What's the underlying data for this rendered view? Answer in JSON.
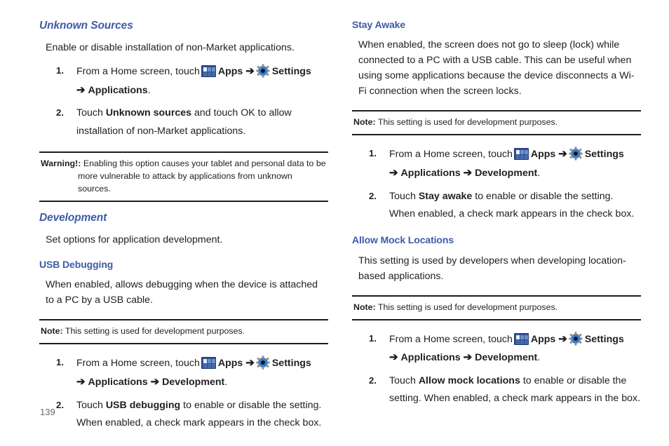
{
  "page": {
    "number": "139",
    "accent_heading_color": "#3d5ba9",
    "rule_color": "#1c1c1c",
    "body_color": "#1f1f1f"
  },
  "icons": {
    "apps": "apps-grid-icon",
    "settings": "settings-gear-icon",
    "arrow": "➔"
  },
  "left_column": {
    "section_unknown_sources": {
      "heading": "Unknown Sources",
      "intro": "Enable or disable installation of non-Market applications.",
      "steps": [
        {
          "number": "1.",
          "pre": "From a Home screen, touch",
          "apps_label": "Apps",
          "settings_label": "Settings",
          "tail_bold": "Applications",
          "tail_end": "."
        },
        {
          "number": "2.",
          "lead": "Touch",
          "bold": "Unknown sources",
          "rest": "and touch OK to allow installation of non-Market applications."
        }
      ]
    },
    "warning_callout": {
      "lead": "Warning!:",
      "line1": "Enabling this option causes your tablet and personal data to be",
      "line2": "more vulnerable to attack by applications from unknown sources."
    },
    "section_development": {
      "heading": "Development",
      "intro": "Set options for application development."
    },
    "section_usb_debugging": {
      "heading": "USB Debugging",
      "intro": "When enabled, allows debugging when the device is attached to a PC by a USB cable.",
      "note": {
        "lead": "Note:",
        "text": "This setting is used for development purposes."
      },
      "steps": [
        {
          "number": "1.",
          "pre": "From a Home screen, touch",
          "apps_label": "Apps",
          "settings_label": "Settings",
          "tail_bold1": "Applications",
          "tail_bold2": "Development",
          "tail_end": "."
        },
        {
          "number": "2.",
          "lead": "Touch",
          "bold": "USB debugging",
          "rest": "to enable or disable the setting. When enabled, a check mark appears in the check box."
        }
      ]
    }
  },
  "right_column": {
    "section_stay_awake": {
      "heading": "Stay Awake",
      "intro": "When enabled, the screen does not go to sleep (lock) while connected to a PC with a USB cable. This can be useful when using some applications because the device disconnects a Wi-Fi connection when the screen locks.",
      "note": {
        "lead": "Note:",
        "text": "This setting is used for development purposes."
      },
      "steps": [
        {
          "number": "1.",
          "pre": "From a Home screen, touch",
          "apps_label": "Apps",
          "settings_label": "Settings",
          "tail_bold1": "Applications",
          "tail_bold2": "Development",
          "tail_end": "."
        },
        {
          "number": "2.",
          "lead": "Touch",
          "bold": "Stay awake",
          "rest": "to enable or disable the setting. When enabled, a check mark appears in the check box."
        }
      ]
    },
    "section_allow_mock_locations": {
      "heading": "Allow Mock Locations",
      "intro": "This setting is used by developers when developing location-based applications.",
      "note": {
        "lead": "Note:",
        "text": "This setting is used for development purposes."
      },
      "steps": [
        {
          "number": "1.",
          "pre": "From a Home screen, touch",
          "apps_label": "Apps",
          "settings_label": "Settings",
          "tail_bold1": "Applications",
          "tail_bold2": "Development",
          "tail_end": "."
        },
        {
          "number": "2.",
          "lead": "Touch",
          "bold": "Allow mock locations",
          "rest": "to enable or disable the setting. When enabled, a check mark appears in the box."
        }
      ]
    }
  }
}
